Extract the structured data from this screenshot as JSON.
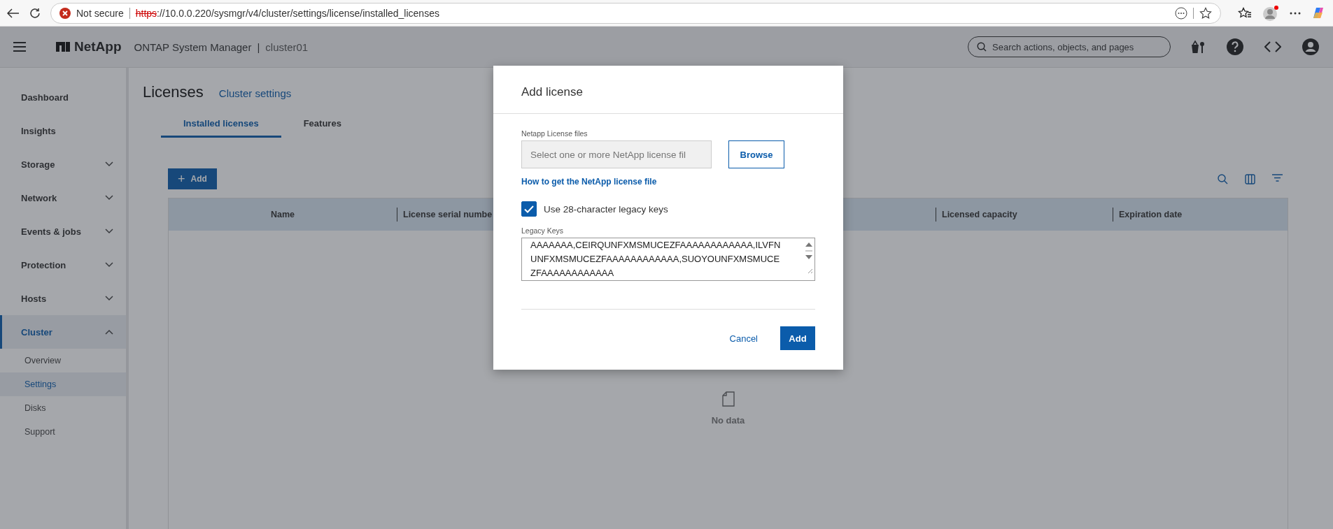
{
  "browser": {
    "security_label": "Not secure",
    "url_scheme": "https",
    "url_rest": "://10.0.0.220/sysmgr/v4/cluster/settings/license/installed_licenses"
  },
  "header": {
    "brand": "NetApp",
    "product": "ONTAP System Manager",
    "separator": "|",
    "cluster": "cluster01",
    "search_placeholder": "Search actions, objects, and pages"
  },
  "sidebar": {
    "items": [
      {
        "label": "Dashboard",
        "selected": false
      },
      {
        "label": "Insights",
        "selected": false
      },
      {
        "label": "Storage",
        "selected": false,
        "expanded": false
      },
      {
        "label": "Network",
        "selected": false,
        "expanded": false
      },
      {
        "label": "Events & jobs",
        "selected": false,
        "expanded": false
      },
      {
        "label": "Protection",
        "selected": false,
        "expanded": false
      },
      {
        "label": "Hosts",
        "selected": false,
        "expanded": false
      },
      {
        "label": "Cluster",
        "selected": true,
        "expanded": true,
        "children": [
          {
            "label": "Overview",
            "selected": false
          },
          {
            "label": "Settings",
            "selected": true
          },
          {
            "label": "Disks",
            "selected": false
          },
          {
            "label": "Support",
            "selected": false
          }
        ]
      }
    ]
  },
  "page": {
    "title": "Licenses",
    "breadcrumb_link": "Cluster settings",
    "tabs": [
      {
        "label": "Installed licenses",
        "selected": true
      },
      {
        "label": "Features",
        "selected": false
      }
    ],
    "add_button": {
      "icon": "+",
      "label": "Add"
    },
    "table": {
      "columns": [
        "Name",
        "License serial numbe",
        "Licensed capacity",
        "Expiration date"
      ],
      "empty_text": "No data"
    }
  },
  "dialog": {
    "title": "Add license",
    "files_label": "Netapp License files",
    "files_placeholder": "Select one or more NetApp license fil",
    "browse_button": "Browse",
    "help_link": "How to get the NetApp license file",
    "legacy_checkbox": {
      "label": "Use 28-character legacy keys",
      "checked": true
    },
    "legacy_keys_label": "Legacy Keys",
    "legacy_keys_lines": [
      "AAAAAAA,CEIRQUNFXMSMUCEZFAAAAAAAAAAAA,ILVFN",
      "UNFXMSMUCEZFAAAAAAAAAAAA,SUOYOUNFXMSMUCE",
      "ZFAAAAAAAAAAAA"
    ],
    "cancel_button": "Cancel",
    "add_button": "Add"
  }
}
